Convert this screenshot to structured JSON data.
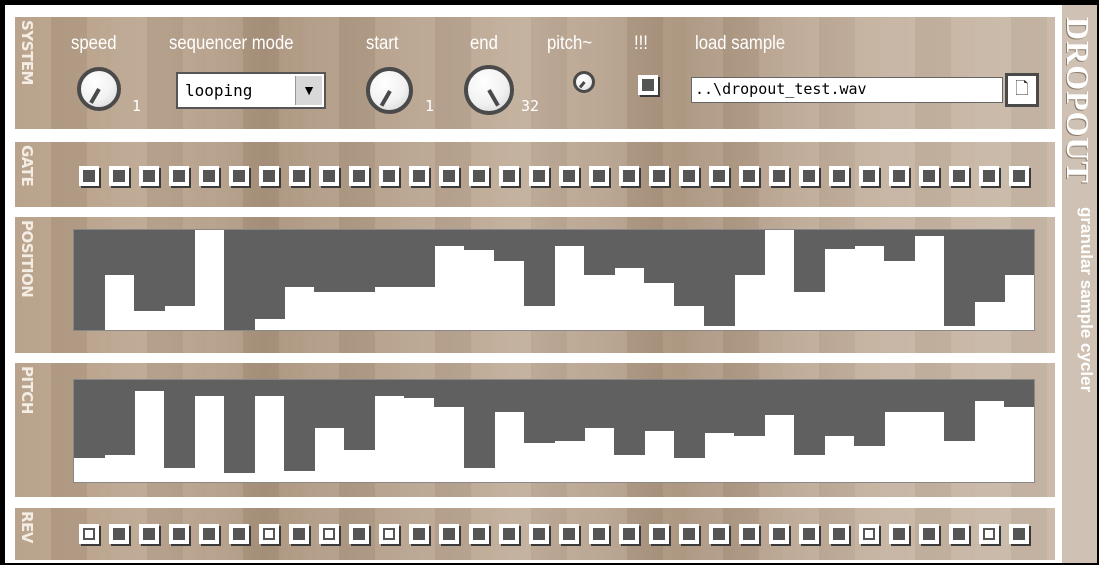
{
  "brand": {
    "logo": "DROPOUT",
    "subtitle": "granular sample cycler"
  },
  "system": {
    "label": "SYSTEM",
    "speed": {
      "label": "speed",
      "value": "1"
    },
    "sequencer_mode": {
      "label": "sequencer mode",
      "value": "looping"
    },
    "start": {
      "label": "start",
      "value": "1"
    },
    "end": {
      "label": "end",
      "value": "32"
    },
    "pitch": {
      "label": "pitch~"
    },
    "bangs": {
      "label": "!!!"
    },
    "load_sample": {
      "label": "load sample",
      "path": "..\\dropout_test.wav"
    }
  },
  "gate": {
    "label": "GATE",
    "steps": [
      0,
      0,
      0,
      0,
      0,
      0,
      0,
      0,
      0,
      0,
      0,
      0,
      0,
      0,
      0,
      0,
      0,
      0,
      0,
      0,
      0,
      0,
      0,
      0,
      0,
      0,
      0,
      0,
      0,
      0,
      0,
      0
    ]
  },
  "position": {
    "label": "POSITION",
    "values": [
      0,
      0.55,
      0.19,
      0.24,
      1.0,
      0,
      0.11,
      0.43,
      0.38,
      0.38,
      0.43,
      0.43,
      0.84,
      0.8,
      0.69,
      0.24,
      0.84,
      0.55,
      0.62,
      0.47,
      0.24,
      0.04,
      0.55,
      1.0,
      0.38,
      0.81,
      0.84,
      0.69,
      0.94,
      0.04,
      0.28,
      0.55
    ]
  },
  "pitch": {
    "label": "PITCH",
    "values": [
      0.24,
      0.26,
      0.89,
      0.14,
      0.84,
      0.09,
      0.84,
      0.11,
      0.53,
      0.31,
      0.84,
      0.82,
      0.74,
      0.14,
      0.69,
      0.38,
      0.4,
      0.53,
      0.26,
      0.5,
      0.24,
      0.48,
      0.45,
      0.66,
      0.26,
      0.45,
      0.35,
      0.69,
      0.69,
      0.4,
      0.79,
      0.74
    ]
  },
  "rev": {
    "label": "REV",
    "steps": [
      1,
      0,
      0,
      0,
      0,
      0,
      1,
      0,
      1,
      0,
      1,
      0,
      0,
      0,
      0,
      0,
      0,
      0,
      0,
      0,
      0,
      0,
      0,
      0,
      0,
      0,
      1,
      0,
      0,
      0,
      1,
      0
    ]
  }
}
